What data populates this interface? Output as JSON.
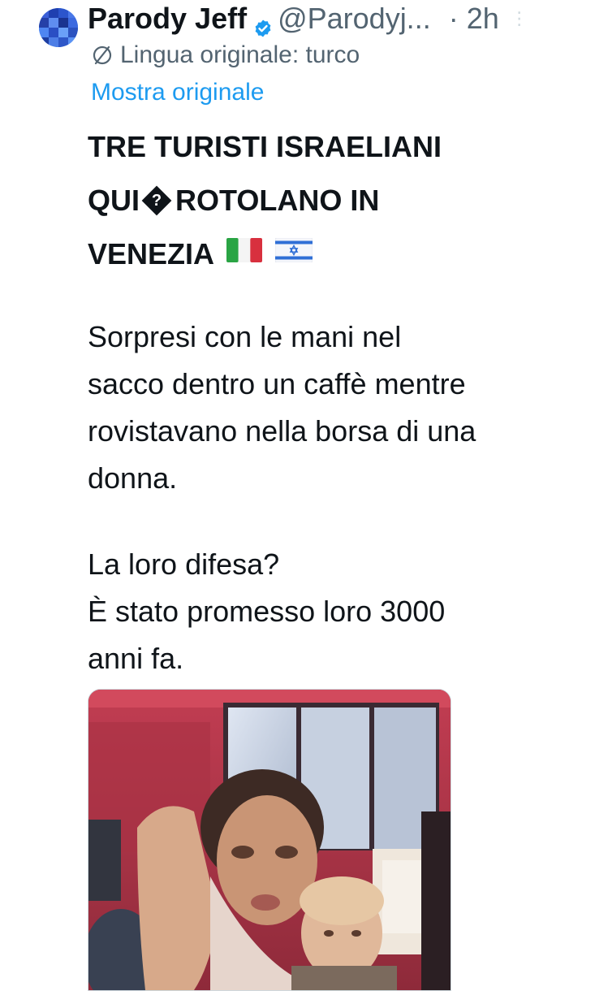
{
  "tweet": {
    "display_name": "Parody Jeff",
    "handle": "@Parodyj...",
    "time": "· 2h",
    "more_icon": "⋮",
    "translation_notice": "Lingua originale: turco",
    "show_original_label": "Mostra originale",
    "headline_lines": [
      "TRE TURISTI ISRAELIANI",
      "QUI",
      "ROTOLANO IN",
      "VENEZIA"
    ],
    "replacement_glyph": "?",
    "paragraph1_lines": [
      "Sorpresi con le mani nel",
      "sacco dentro un caffè mentre",
      "rovistavano nella borsa di una",
      "donna."
    ],
    "paragraph2_lines": [
      "La loro difesa?",
      "È stato promesso loro 3000",
      "anni fa."
    ]
  },
  "icons": {
    "verified": "verified-badge-icon",
    "globe": "no-translation-globe-icon",
    "flag_italy": "italy-flag-icon",
    "flag_israel": "israel-flag-icon"
  },
  "colors": {
    "text": "#0f1419",
    "secondary": "#536471",
    "link": "#1d9bf0",
    "verified": "#1d9bf0",
    "media_accent": "#b73446"
  }
}
